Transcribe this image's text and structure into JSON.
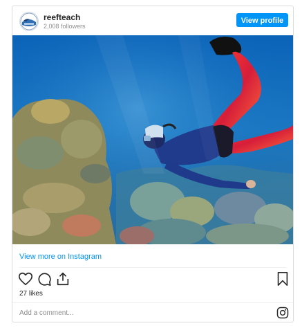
{
  "header": {
    "username": "reefteach",
    "followers": "2,008 followers",
    "view_profile_label": "View profile",
    "avatar_icon": "reefteach-logo-icon"
  },
  "post": {
    "image_subject": "snorkeler-over-coral-reef",
    "view_more_label": "View more on Instagram",
    "likes": "27 likes",
    "comment_placeholder": "Add a comment..."
  },
  "actions": {
    "like_icon": "heart-icon",
    "comment_icon": "comment-icon",
    "share_icon": "share-icon",
    "save_icon": "bookmark-icon"
  },
  "colors": {
    "accent": "#0095f6",
    "text": "#262626",
    "muted": "#8e8e8e",
    "border": "#dbdbdb"
  }
}
